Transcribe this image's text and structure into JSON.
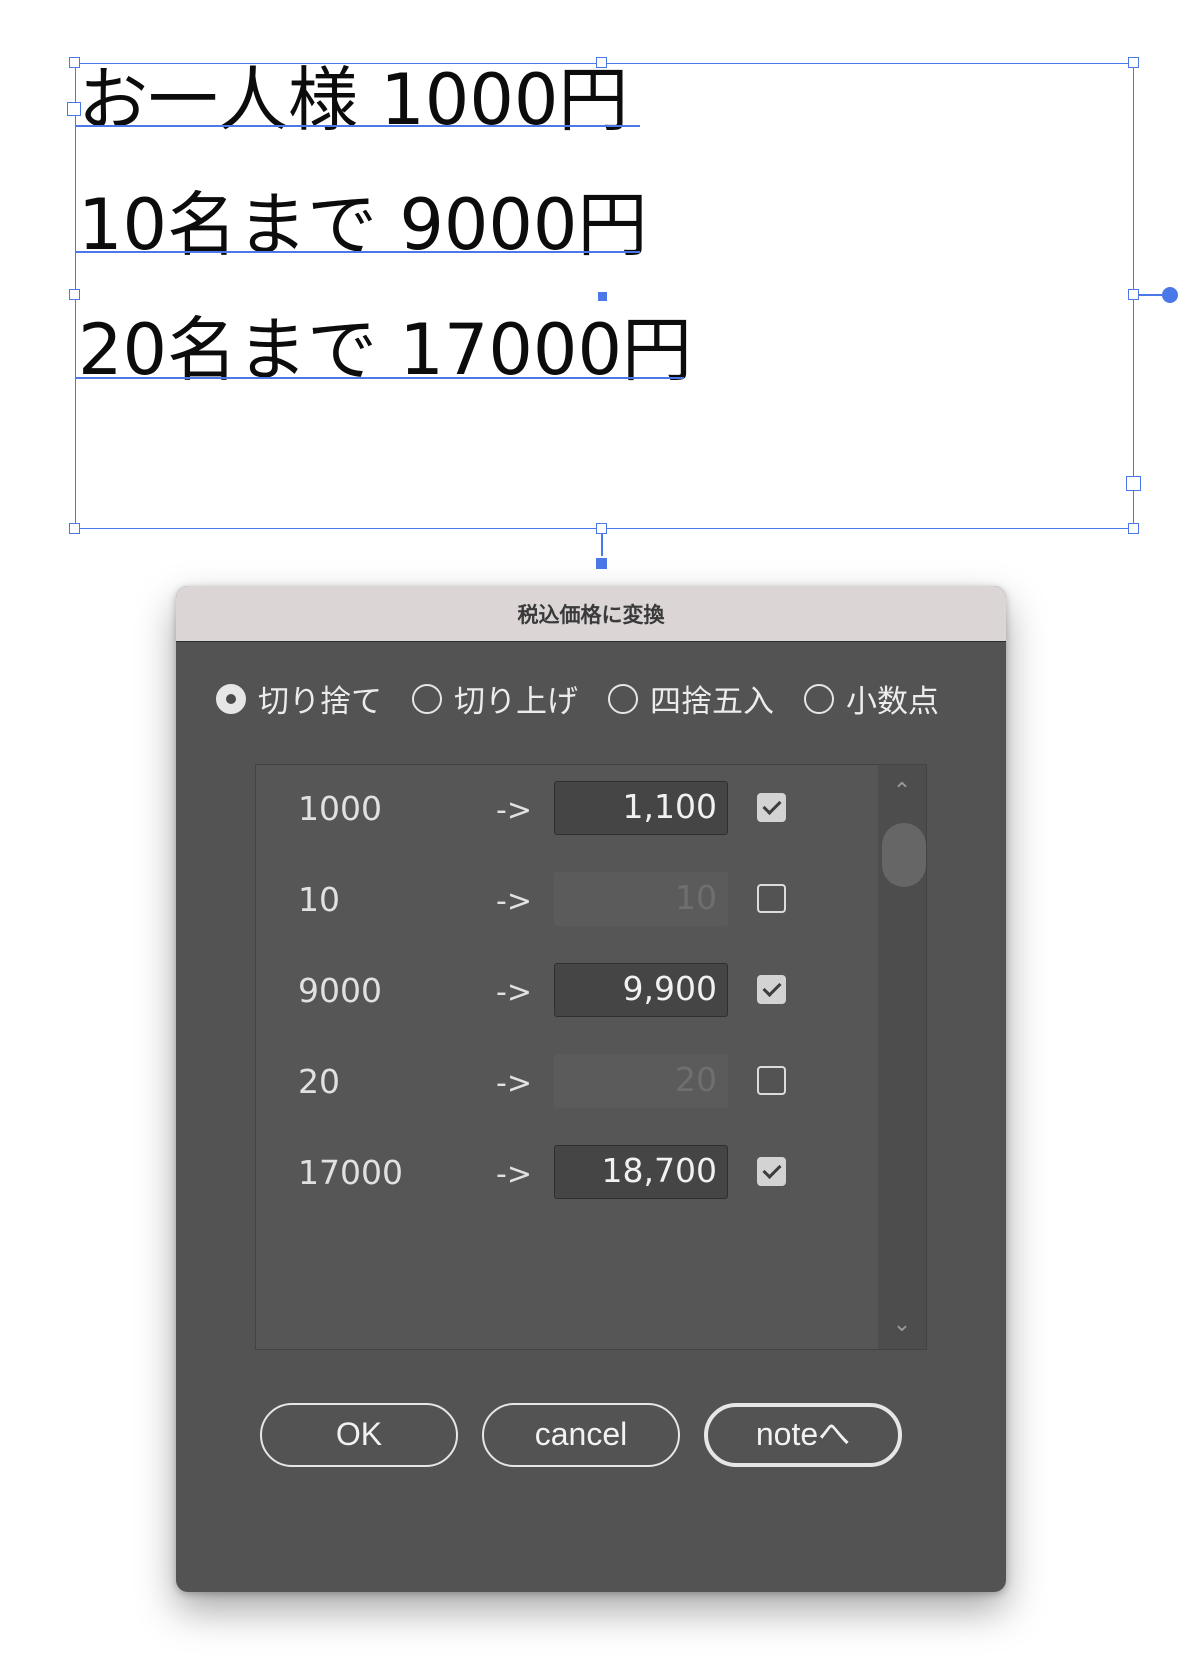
{
  "canvas": {
    "lines": [
      "お一人様  1000円",
      "10名まで 9000円",
      "20名まで 17000円"
    ]
  },
  "dialog": {
    "title": "税込価格に変換",
    "radios": [
      {
        "label": "切り捨て",
        "checked": true
      },
      {
        "label": "切り上げ",
        "checked": false
      },
      {
        "label": "四捨五入",
        "checked": false
      },
      {
        "label": "小数点",
        "checked": false
      }
    ],
    "rows": [
      {
        "original": "1000",
        "arrow": "->",
        "converted": "1,100",
        "enabled": true,
        "checked": true
      },
      {
        "original": "10",
        "arrow": "->",
        "converted": "10",
        "enabled": false,
        "checked": false
      },
      {
        "original": "9000",
        "arrow": "->",
        "converted": "9,900",
        "enabled": true,
        "checked": true
      },
      {
        "original": "20",
        "arrow": "->",
        "converted": "20",
        "enabled": false,
        "checked": false
      },
      {
        "original": "17000",
        "arrow": "->",
        "converted": "18,700",
        "enabled": true,
        "checked": true
      }
    ],
    "buttons": {
      "ok": "OK",
      "cancel": "cancel",
      "note": "noteへ"
    }
  },
  "colors": {
    "selection": "#4a78e8",
    "dialog_bg": "#535353",
    "titlebar_bg": "#dbd5d6"
  }
}
